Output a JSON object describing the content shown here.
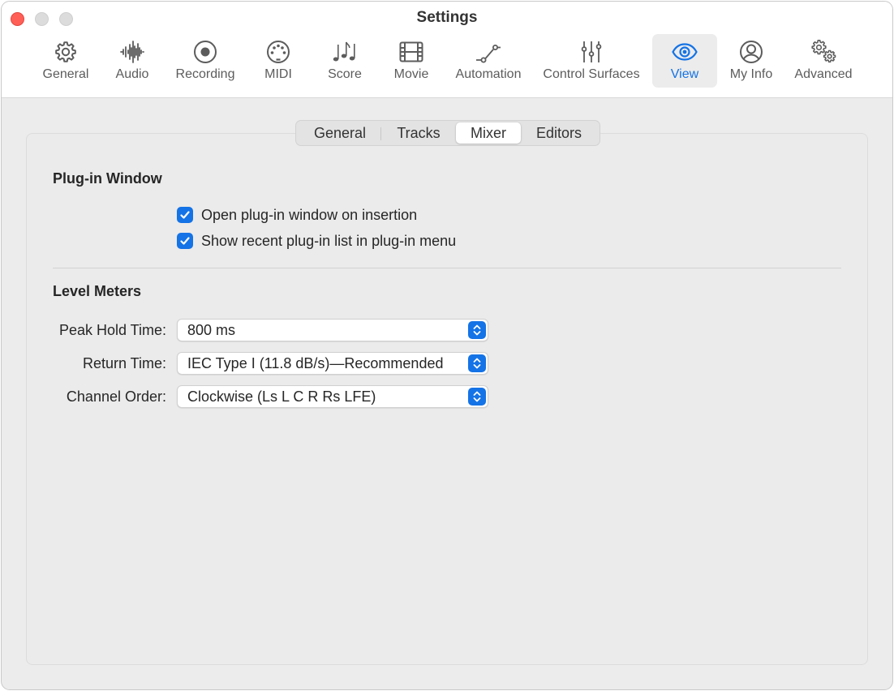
{
  "window": {
    "title": "Settings"
  },
  "toolbar": {
    "items": [
      {
        "label": "General",
        "icon": "gear-icon"
      },
      {
        "label": "Audio",
        "icon": "waveform-icon"
      },
      {
        "label": "Recording",
        "icon": "record-icon"
      },
      {
        "label": "MIDI",
        "icon": "midi-connector-icon"
      },
      {
        "label": "Score",
        "icon": "music-notes-icon"
      },
      {
        "label": "Movie",
        "icon": "film-icon"
      },
      {
        "label": "Automation",
        "icon": "automation-curve-icon"
      },
      {
        "label": "Control Surfaces",
        "icon": "sliders-icon"
      },
      {
        "label": "View",
        "icon": "eye-icon",
        "selected": true
      },
      {
        "label": "My Info",
        "icon": "person-icon"
      },
      {
        "label": "Advanced",
        "icon": "gears-icon"
      }
    ]
  },
  "tabs": {
    "items": [
      "General",
      "Tracks",
      "Mixer",
      "Editors"
    ],
    "selected": "Mixer"
  },
  "plugin_window": {
    "title": "Plug-in Window",
    "options": [
      {
        "label": "Open plug-in window on insertion",
        "checked": true
      },
      {
        "label": "Show recent plug-in list in plug-in menu",
        "checked": true
      }
    ]
  },
  "level_meters": {
    "title": "Level Meters",
    "fields": [
      {
        "label": "Peak Hold Time:",
        "value": "800 ms"
      },
      {
        "label": "Return Time:",
        "value": "IEC Type I (11.8 dB/s)—Recommended"
      },
      {
        "label": "Channel Order:",
        "value": "Clockwise (Ls L C R Rs LFE)"
      }
    ]
  },
  "colors": {
    "accent": "#1473e6",
    "close_button": "#ff5f57",
    "window_background": "#ececec",
    "text": "#262626"
  }
}
